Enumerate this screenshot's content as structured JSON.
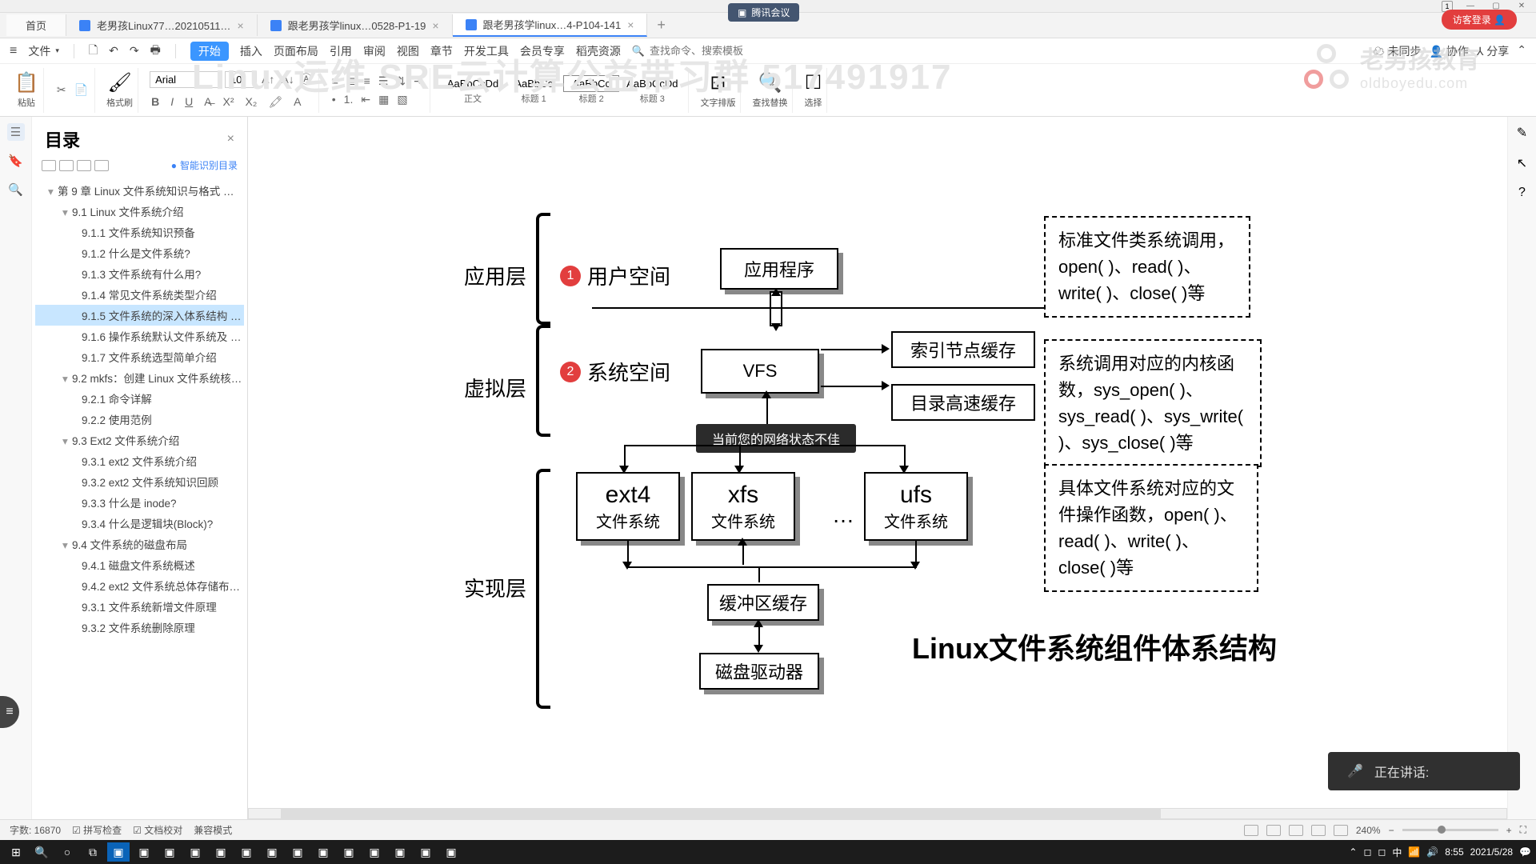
{
  "tencent_badge": "腾讯会议",
  "login_badge": "访客登录",
  "tabs": {
    "home": "首页",
    "t1": "老男孩Linux77…20210511…",
    "t2": "跟老男孩学linux…0528-P1-19",
    "t3": "跟老男孩学linux…4-P104-141"
  },
  "menu": {
    "file": "文件",
    "start": "开始",
    "insert": "插入",
    "layout": "页面布局",
    "ref": "引用",
    "review": "审阅",
    "view": "视图",
    "section": "章节",
    "dev": "开发工具",
    "member": "会员专享",
    "draft": "稻壳资源",
    "search_ph": "查找命令、搜索模板",
    "unsync": "未同步",
    "coop": "协作",
    "share": "分享"
  },
  "toolbar": {
    "paste": "粘贴",
    "fmt": "格式刷",
    "font": "Arial",
    "size": "10",
    "styles": {
      "s1": "AaBbCcDd",
      "s2": "AaBbCc",
      "s3": "AaBbCc",
      "s4": "AaBbCcDd",
      "c1": "正文",
      "c2": "标题 1",
      "c3": "标题 2",
      "c4": "标题 3"
    },
    "arrange": "文字排版",
    "find": "查找替换",
    "select": "选择"
  },
  "watermark": {
    "cn": "老男孩教育",
    "en": "oldboyedu.com",
    "big": "Linux运维 SRE云计算公益带习群 517491917"
  },
  "outline": {
    "title": "目录",
    "smart": "智能识别目录",
    "items": [
      {
        "t": "第 9 章   Linux 文件系统知识与格式 …",
        "l": 0
      },
      {
        "t": "9.1 Linux 文件系统介绍",
        "l": 1
      },
      {
        "t": "9.1.1 文件系统知识预备",
        "l": 2
      },
      {
        "t": "9.1.2 什么是文件系统?",
        "l": 2
      },
      {
        "t": "9.1.3 文件系统有什么用?",
        "l": 2
      },
      {
        "t": "9.1.4 常见文件系统类型介绍",
        "l": 2
      },
      {
        "t": "9.1.5 文件系统的深入体系结构 …",
        "l": 2,
        "active": true
      },
      {
        "t": "9.1.6 操作系统默认文件系统及 …",
        "l": 2
      },
      {
        "t": "9.1.7 文件系统选型简单介绍",
        "l": 2
      },
      {
        "t": "9.2 mkfs：创建 Linux 文件系统核…",
        "l": 1
      },
      {
        "t": "9.2.1     命令详解",
        "l": 2
      },
      {
        "t": "9.2.2     使用范例",
        "l": 2
      },
      {
        "t": "9.3 Ext2 文件系统介绍",
        "l": 1
      },
      {
        "t": "9.3.1 ext2 文件系统介绍",
        "l": 2
      },
      {
        "t": "9.3.2 ext2 文件系统知识回顾",
        "l": 2
      },
      {
        "t": "9.3.3 什么是 inode?",
        "l": 2
      },
      {
        "t": "9.3.4 什么是逻辑块(Block)?",
        "l": 2
      },
      {
        "t": "9.4 文件系统的磁盘布局",
        "l": 1
      },
      {
        "t": "9.4.1 磁盘文件系统概述",
        "l": 2
      },
      {
        "t": "9.4.2 ext2 文件系统总体存储布…",
        "l": 2
      },
      {
        "t": "9.3.1 文件系统新增文件原理",
        "l": 2
      },
      {
        "t": "9.3.2 文件系统删除原理",
        "l": 2
      }
    ]
  },
  "diagram": {
    "layers": {
      "app": "应用层",
      "virt": "虚拟层",
      "impl": "实现层"
    },
    "user_space": "用户空间",
    "sys_space": "系统空间",
    "app_prog": "应用程序",
    "vfs": "VFS",
    "idx_cache": "索引节点缓存",
    "dir_cache": "目录高速缓存",
    "fs": {
      "ext4": "ext4",
      "xfs": "xfs",
      "ufs": "ufs",
      "sub": "文件系统"
    },
    "buf_cache": "缓冲区缓存",
    "disk_drv": "磁盘驱动器",
    "ellipsis": "…",
    "title": "Linux文件系统组件体系结构",
    "callout1": "标准文件类系统调用，open( )、read( )、write( )、close( )等",
    "callout2": "系统调用对应的内核函数，sys_open( )、sys_read( )、sys_write( )、sys_close( )等",
    "callout3": "具体文件系统对应的文件操作函数，open( )、read( )、write( )、close( )等",
    "net_toast": "当前您的网络状态不佳"
  },
  "speaking": "正在讲话:",
  "status": {
    "words": "字数: 16870",
    "spell": "拼写检查",
    "proof": "文档校对",
    "compat": "兼容模式",
    "zoom": "240%"
  },
  "task": {
    "time": "8:55",
    "date": "2021/5/28"
  }
}
